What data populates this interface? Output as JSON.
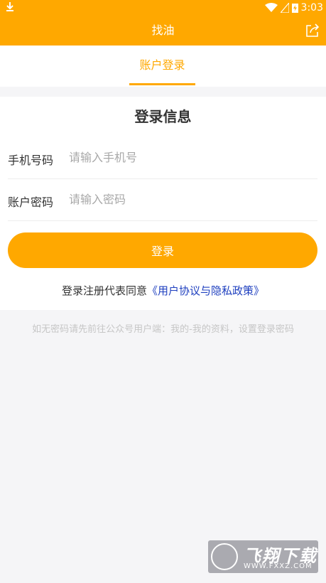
{
  "status_bar": {
    "time": "3:03"
  },
  "app_bar": {
    "title": "找油"
  },
  "tabs": [
    {
      "label": "账户登录"
    }
  ],
  "form": {
    "heading": "登录信息",
    "phone": {
      "label": "手机号码",
      "placeholder": "请输入手机号"
    },
    "password": {
      "label": "账户密码",
      "placeholder": "请输入密码"
    },
    "submit_label": "登录",
    "agreement_prefix": "登录注册代表同意",
    "agreement_link": "《用户协议与隐私政策》"
  },
  "hint": "如无密码请先前往公众号用户端：我的-我的资料，设置登录密码",
  "watermark": {
    "name": "飞翔下载",
    "url": "WWW.FXXZ.COM"
  },
  "colors": {
    "accent": "#ffa800",
    "link": "#1e3fbf"
  }
}
